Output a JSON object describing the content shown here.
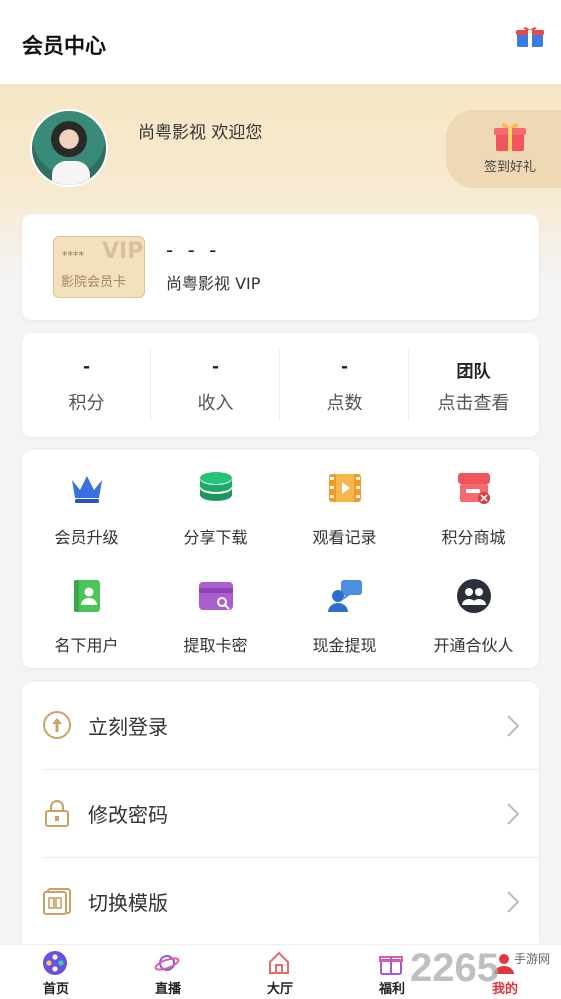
{
  "header": {
    "title": "会员中心",
    "gift_icon": "gift-box-icon"
  },
  "profile": {
    "welcome": "尚粤影视 欢迎您",
    "signin_label": "签到好礼",
    "signin_icon": "gift-icon"
  },
  "vip_card": {
    "chip_stars": "****",
    "chip_vip": "VIP",
    "chip_name": "影院会员卡",
    "status": "- - -",
    "subtitle": "尚粤影视 VIP"
  },
  "stats": [
    {
      "value": "-",
      "label": "积分"
    },
    {
      "value": "-",
      "label": "收入"
    },
    {
      "value": "-",
      "label": "点数"
    },
    {
      "value": "团队",
      "label": "点击查看"
    }
  ],
  "features": [
    {
      "label": "会员升级",
      "icon": "crown-icon"
    },
    {
      "label": "分享下载",
      "icon": "coin-stack-icon"
    },
    {
      "label": "观看记录",
      "icon": "film-play-icon"
    },
    {
      "label": "积分商城",
      "icon": "shop-icon"
    },
    {
      "label": "名下用户",
      "icon": "contact-book-icon"
    },
    {
      "label": "提取卡密",
      "icon": "card-key-icon"
    },
    {
      "label": "现金提现",
      "icon": "user-chat-icon"
    },
    {
      "label": "开通合伙人",
      "icon": "partners-icon"
    }
  ],
  "menu": [
    {
      "label": "立刻登录",
      "icon": "login-icon"
    },
    {
      "label": "修改密码",
      "icon": "lock-icon"
    },
    {
      "label": "切换模版",
      "icon": "template-icon"
    }
  ],
  "tabs": [
    {
      "label": "首页",
      "icon": "film-reel-icon"
    },
    {
      "label": "直播",
      "icon": "planet-icon"
    },
    {
      "label": "大厅",
      "icon": "home-icon"
    },
    {
      "label": "福利",
      "icon": "gift-icon"
    },
    {
      "label": "我的",
      "icon": "user-icon",
      "active": true
    }
  ],
  "watermark": {
    "number": "2265",
    "text": "手游网"
  },
  "colors": {
    "accent": "#e2363c",
    "gold": "#c9a267",
    "hero_bg": "#f6e6c4"
  }
}
